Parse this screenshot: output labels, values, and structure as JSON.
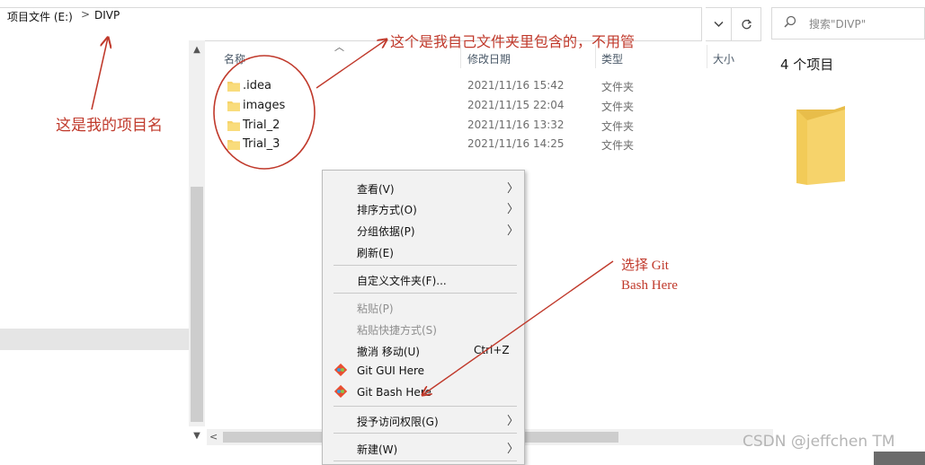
{
  "breadcrumb": {
    "drive": "项目文件 (E:)",
    "separator": ">",
    "folder": "DIVP"
  },
  "toolbar": {
    "dropdown_icon": "chevron-down-icon",
    "refresh_icon": "refresh-icon"
  },
  "search": {
    "placeholder": "搜索\"DIVP\""
  },
  "columns": {
    "name": "名称",
    "modified": "修改日期",
    "type": "类型",
    "size": "大小"
  },
  "files": [
    {
      "name": ".idea",
      "modified": "2021/11/16 15:42",
      "type": "文件夹"
    },
    {
      "name": "images",
      "modified": "2021/11/15 22:04",
      "type": "文件夹"
    },
    {
      "name": "Trial_2",
      "modified": "2021/11/16 13:32",
      "type": "文件夹"
    },
    {
      "name": "Trial_3",
      "modified": "2021/11/16 14:25",
      "type": "文件夹"
    }
  ],
  "preview": {
    "item_count": "4 个项目"
  },
  "context_menu": {
    "view": "查看(V)",
    "sort": "排序方式(O)",
    "group": "分组依据(P)",
    "refresh": "刷新(E)",
    "customize": "自定义文件夹(F)...",
    "paste": "粘贴(P)",
    "paste_shortcut": "粘贴快捷方式(S)",
    "undo": "撤消 移动(U)",
    "undo_shortcut": "Ctrl+Z",
    "git_gui": "Git GUI Here",
    "git_bash": "Git Bash Here",
    "give_access": "授予访问权限(G)",
    "new": "新建(W)"
  },
  "annotations": {
    "project_name": "这是我的项目名",
    "folder_note": "这个是我自己文件夹里包含的，不用管",
    "select_line1": "选择  Git",
    "select_line2": "Bash Here"
  },
  "watermark": "CSDN @jeffchen TM",
  "colors": {
    "annotation": "#c0392b",
    "folder": "#f6d36b",
    "menu_bg": "#f2f2f2"
  }
}
